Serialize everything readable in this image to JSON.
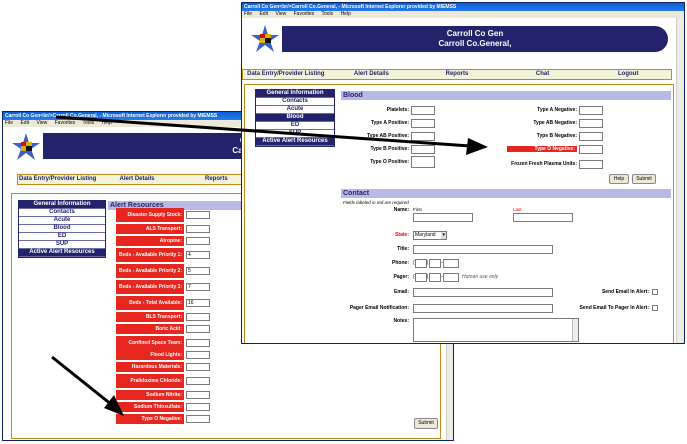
{
  "back_window": {
    "title": "Carroll Co Gen<br/>Carroll Co.General, - Microsoft Internet Explorer provided by MIEMSS",
    "menu": [
      "File",
      "Edit",
      "View",
      "Favorites",
      "Tools",
      "Help"
    ],
    "banner": [
      "Carroll Co G",
      "Carroll Co.Ger"
    ],
    "nav": [
      "Data Entry/Provider Listing",
      "Alert Details",
      "Reports"
    ],
    "sidebar": [
      "General Information",
      "Contacts",
      "Acute",
      "Blood",
      "ED",
      "SUP",
      "Active Alert Resources"
    ],
    "section_title": "Alert Resources",
    "fields": [
      {
        "label": "Disaster Supply Stock:",
        "value": ""
      },
      {
        "label": "ALS Transport:",
        "value": ""
      },
      {
        "label": "Atropine:",
        "value": ""
      },
      {
        "label": "Beds - Available Priority 1:",
        "value": "4"
      },
      {
        "label": "Beds - Available Priority 2:",
        "value": "5"
      },
      {
        "label": "Beds - Available Priority 3:",
        "value": "7"
      },
      {
        "label": "Beds - Total Available:",
        "value": "16"
      },
      {
        "label": "BLS Transport:",
        "value": ""
      },
      {
        "label": "Boric Acid:",
        "value": ""
      },
      {
        "label": "Confined Space Team:",
        "value": ""
      },
      {
        "label": "Flood Lights:",
        "value": ""
      },
      {
        "label": "Hazardous Materials:",
        "value": ""
      },
      {
        "label": "Pralidoxime Chloride:",
        "value": ""
      },
      {
        "label": "Sodium Nitrite:",
        "value": ""
      },
      {
        "label": "Sodium Thiosulfate:",
        "value": ""
      },
      {
        "label": "Type O Negative:",
        "value": ""
      }
    ],
    "submit": "Submit"
  },
  "front_window": {
    "title": "Carroll Co Gen<br/>Carroll Co.General, - Microsoft Internet Explorer provided by MIEMSS",
    "menu": [
      "File",
      "Edit",
      "View",
      "Favorites",
      "Tools",
      "Help"
    ],
    "banner": [
      "Carroll Co Gen",
      "Carroll Co.General,"
    ],
    "nav": [
      "Data Entry/Provider Listing",
      "Alert Details",
      "Reports",
      "Chat",
      "Logout"
    ],
    "sidebar": [
      "General Information",
      "Contacts",
      "Acute",
      "Blood",
      "ED",
      "SUP",
      "Active Alert Resources"
    ],
    "blood": {
      "title": "Blood",
      "left": [
        "Platelets:",
        "Type A Positive:",
        "Type AB Positive:",
        "Type B Positive:",
        "Type O Positive:"
      ],
      "right": [
        "Type A Negative:",
        "Type AB Negative:",
        "Type B Negative:",
        "Type O Negative:",
        "Frozen Fresh Plasma Units:"
      ],
      "help": "Help",
      "submit": "Submit"
    },
    "contact": {
      "title": "Contact",
      "required_note": "Fields labeled in red are required",
      "name": "Name:",
      "first": "First",
      "last": "Last",
      "state": "State:",
      "state_value": "Maryland",
      "title_label": "Title:",
      "phone": "Phone:",
      "pager": "Pager:",
      "human_use": "Human use only",
      "email": "Email:",
      "send_email": "Send Email In Alert:",
      "pager_email": "Pager Email Notification:",
      "send_pager": "Send Email To Pager In Alert:",
      "notes": "Notes:"
    }
  }
}
